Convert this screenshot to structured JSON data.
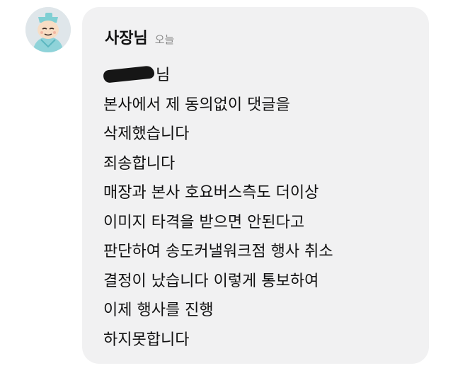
{
  "chat": {
    "sender": "사장님",
    "time": "오늘",
    "avatar_icon": "character-avatar",
    "bubble_color": "#f1f1f2",
    "lines": [
      "님",
      "본사에서 제 동의없이 댓글을",
      "삭제했습니다",
      "죄송합니다",
      "매장과 본사 호요버스측도 더이상",
      "이미지 타격을 받으면 안된다고",
      "판단하여 송도커낼워크점 행사 취소",
      "결정이 났습니다 이렇게 통보하여",
      "이제 행사를 진행",
      "하지못합니다"
    ]
  }
}
